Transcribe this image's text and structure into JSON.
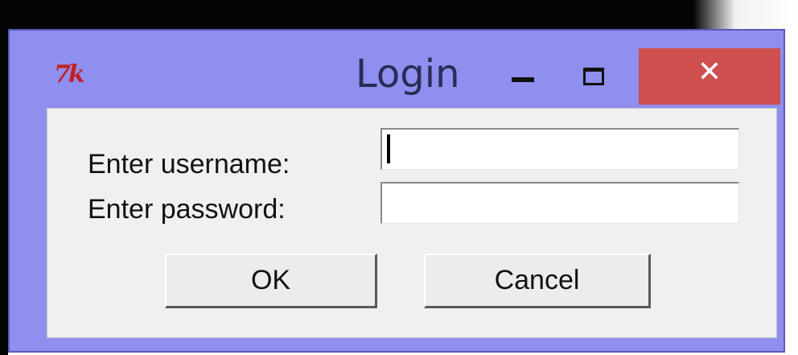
{
  "window": {
    "title": "Login",
    "app_icon": "tk-icon",
    "app_icon_text": "7k",
    "controls": {
      "minimize_icon": "minimize-icon",
      "maximize_icon": "maximize-icon",
      "close_icon": "close-icon",
      "close_glyph": "✕"
    },
    "colors": {
      "frame": "#8f8ff0",
      "close_button": "#cf4f4f",
      "client_area": "#f0f0f0"
    }
  },
  "form": {
    "username_label": "Enter username:",
    "password_label": "Enter password:",
    "username_value": "",
    "password_value": "",
    "ok_label": "OK",
    "cancel_label": "Cancel"
  }
}
